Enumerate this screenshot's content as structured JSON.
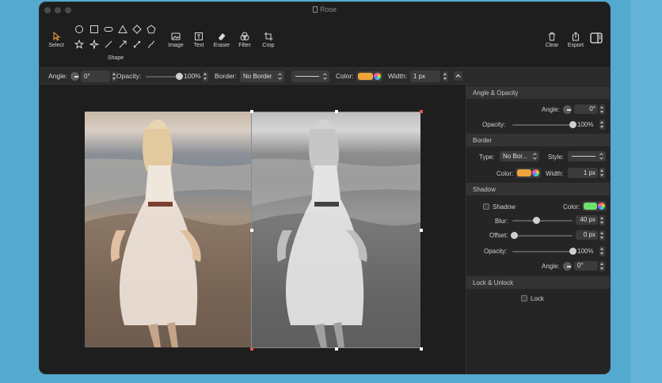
{
  "window": {
    "title": "Rose"
  },
  "toolbar": {
    "select_label": "Select",
    "shape_label": "Shape",
    "image_label": "Image",
    "text_label": "Text",
    "eraser_label": "Eraser",
    "filter_label": "Filter",
    "crop_label": "Crop",
    "clear_label": "Clear",
    "export_label": "Export",
    "shapes": [
      "circle-icon",
      "square-icon",
      "rounded-rect-icon",
      "triangle-icon",
      "diamond-icon",
      "pentagon-icon",
      "star-icon",
      "sparkle-icon",
      "line-icon",
      "arrow-icon",
      "double-arrow-icon",
      "curve-icon"
    ]
  },
  "options": {
    "angle_label": "Angle:",
    "angle_value": "0°",
    "opacity_label": "Opacity:",
    "opacity_value": "100%",
    "opacity_level": 1.0,
    "border_label": "Border:",
    "border_value": "No Border",
    "color_label": "Color:",
    "color": "#f0a43a",
    "width_label": "Width:",
    "width_value": "1 px"
  },
  "panel": {
    "angle_opacity": {
      "title": "Angle & Opacity",
      "angle_label": "Angle:",
      "angle_value": "0°",
      "opacity_label": "Opacity:",
      "opacity_value": "100%",
      "opacity_level": 1.0
    },
    "border": {
      "title": "Border",
      "type_label": "Type:",
      "type_value": "No Bor...",
      "style_label": "Style:",
      "color_label": "Color:",
      "color": "#f0a43a",
      "width_label": "Width:",
      "width_value": "1 px"
    },
    "shadow": {
      "title": "Shadow",
      "shadow_label": "Shadow",
      "color_label": "Color:",
      "color": "#6ee06e",
      "blur_label": "Blur:",
      "blur_value": "40 px",
      "blur_level": 0.4,
      "offset_label": "Offset:",
      "offset_value": "0 px",
      "offset_level": 0.0,
      "opacity_label": "Opacity:",
      "opacity_value": "100%",
      "opacity_level": 1.0,
      "angle_label": "Angle:",
      "angle_value": "0°"
    },
    "lock": {
      "title": "Lock & Unlock",
      "lock_label": "Lock"
    }
  }
}
